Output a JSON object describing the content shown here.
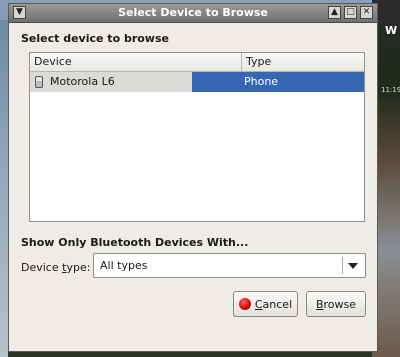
{
  "desktop": {
    "corner_text": "W",
    "clock_text": "11:19"
  },
  "window": {
    "title": "Select Device to Browse"
  },
  "dialog": {
    "heading": "Select device to browse",
    "list": {
      "columns": [
        "Device",
        "Type"
      ],
      "rows": [
        {
          "device": "Motorola L6",
          "type": "Phone",
          "icon": "phone-icon",
          "selected": true
        }
      ]
    },
    "filter_heading": "Show Only Bluetooth Devices With...",
    "device_type": {
      "label_pre": "Device ",
      "label_mnemonic": "t",
      "label_post": "ype:",
      "selected": "All types"
    },
    "buttons": {
      "cancel": {
        "mnemonic": "C",
        "rest": "ancel"
      },
      "browse": {
        "mnemonic": "B",
        "rest": "rowse"
      }
    }
  },
  "colors": {
    "selection": "#3567b3",
    "titlebar": "#7a7a7a",
    "dialog_bg": "#efebe7"
  }
}
